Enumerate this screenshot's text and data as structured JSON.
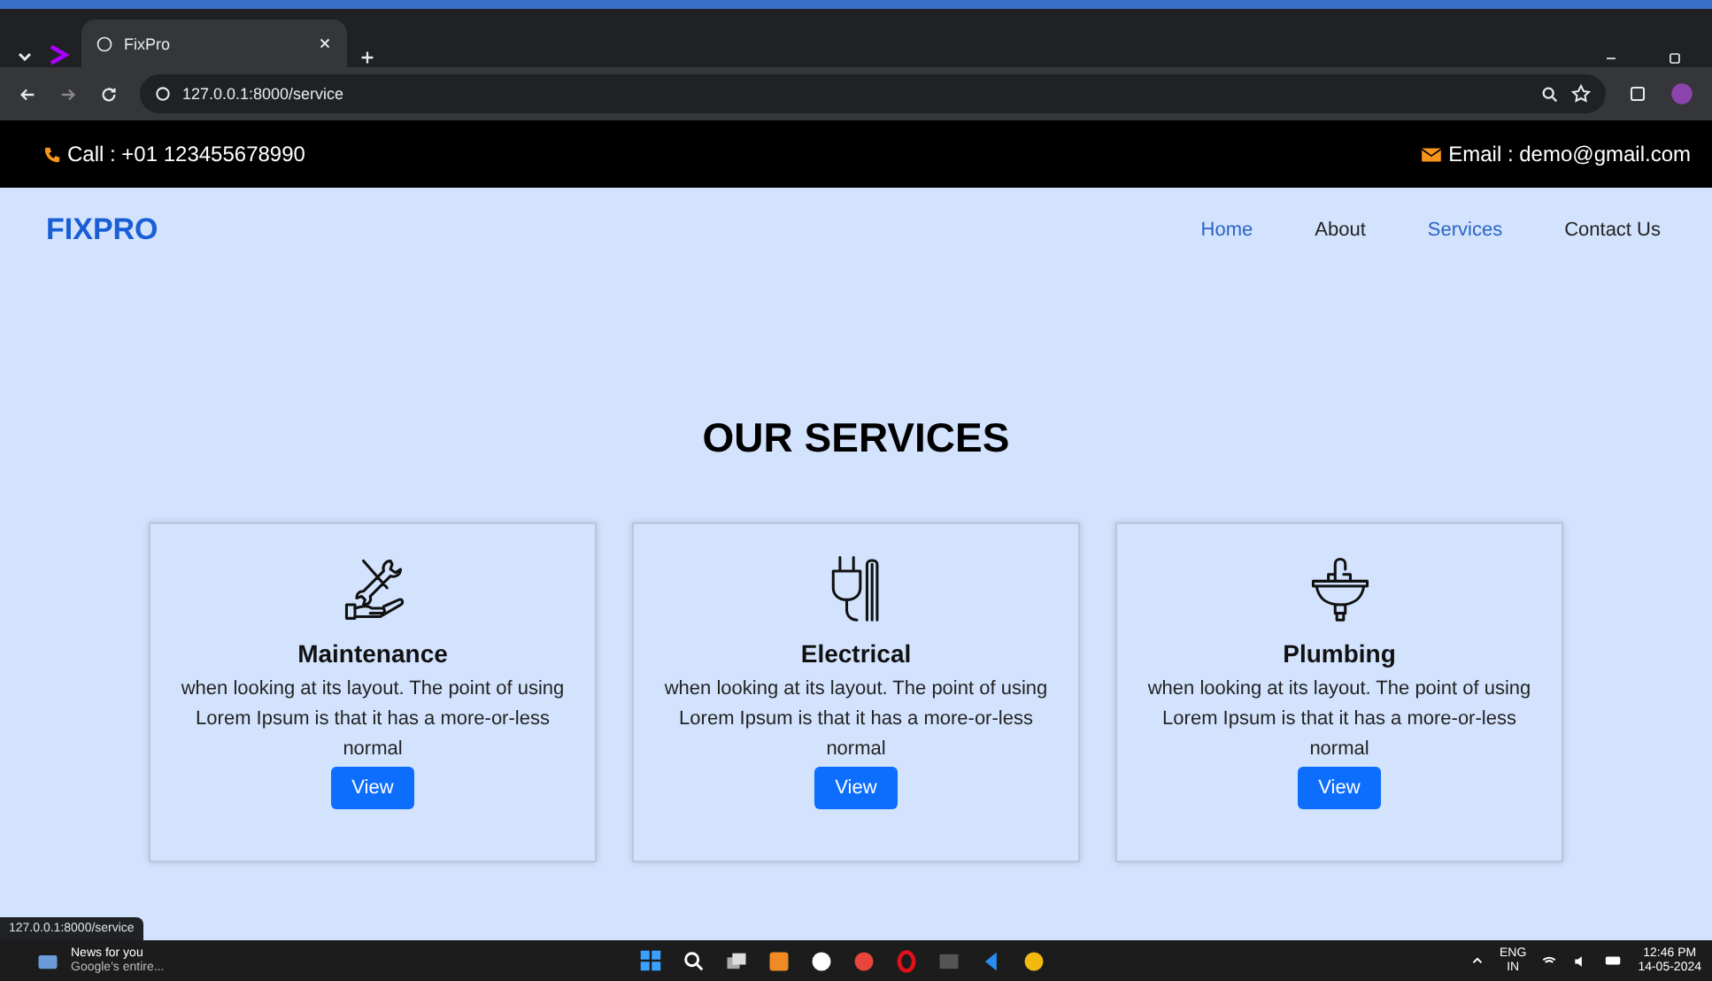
{
  "browser": {
    "tab_title": "FixPro",
    "url": "127.0.0.1:8000/service",
    "status_url": "127.0.0.1:8000/service"
  },
  "topbar": {
    "call": "Call : +01 123455678990",
    "email": "Email : demo@gmail.com"
  },
  "nav": {
    "logo": "FIXPRO",
    "items": [
      {
        "label": "Home",
        "highlighted": true
      },
      {
        "label": "About",
        "highlighted": false
      },
      {
        "label": "Services",
        "highlighted": true
      },
      {
        "label": "Contact Us",
        "highlighted": false
      }
    ]
  },
  "heading": "OUR SERVICES",
  "cards": [
    {
      "kind": "tools",
      "title": "Maintenance",
      "text": "when looking at its layout. The point of using Lorem Ipsum is that it has a more-or-less normal",
      "button": "View"
    },
    {
      "kind": "plug",
      "title": "Electrical",
      "text": "when looking at its layout. The point of using Lorem Ipsum is that it has a more-or-less normal",
      "button": "View"
    },
    {
      "kind": "sink",
      "title": "Plumbing",
      "text": "when looking at its layout. The point of using Lorem Ipsum is that it has a more-or-less normal",
      "button": "View"
    }
  ],
  "taskbar": {
    "news_title": "News for you",
    "news_subtitle": "Google's entire...",
    "lang": "ENG",
    "region": "IN",
    "time": "12:46 PM",
    "date": "14-05-2024"
  }
}
